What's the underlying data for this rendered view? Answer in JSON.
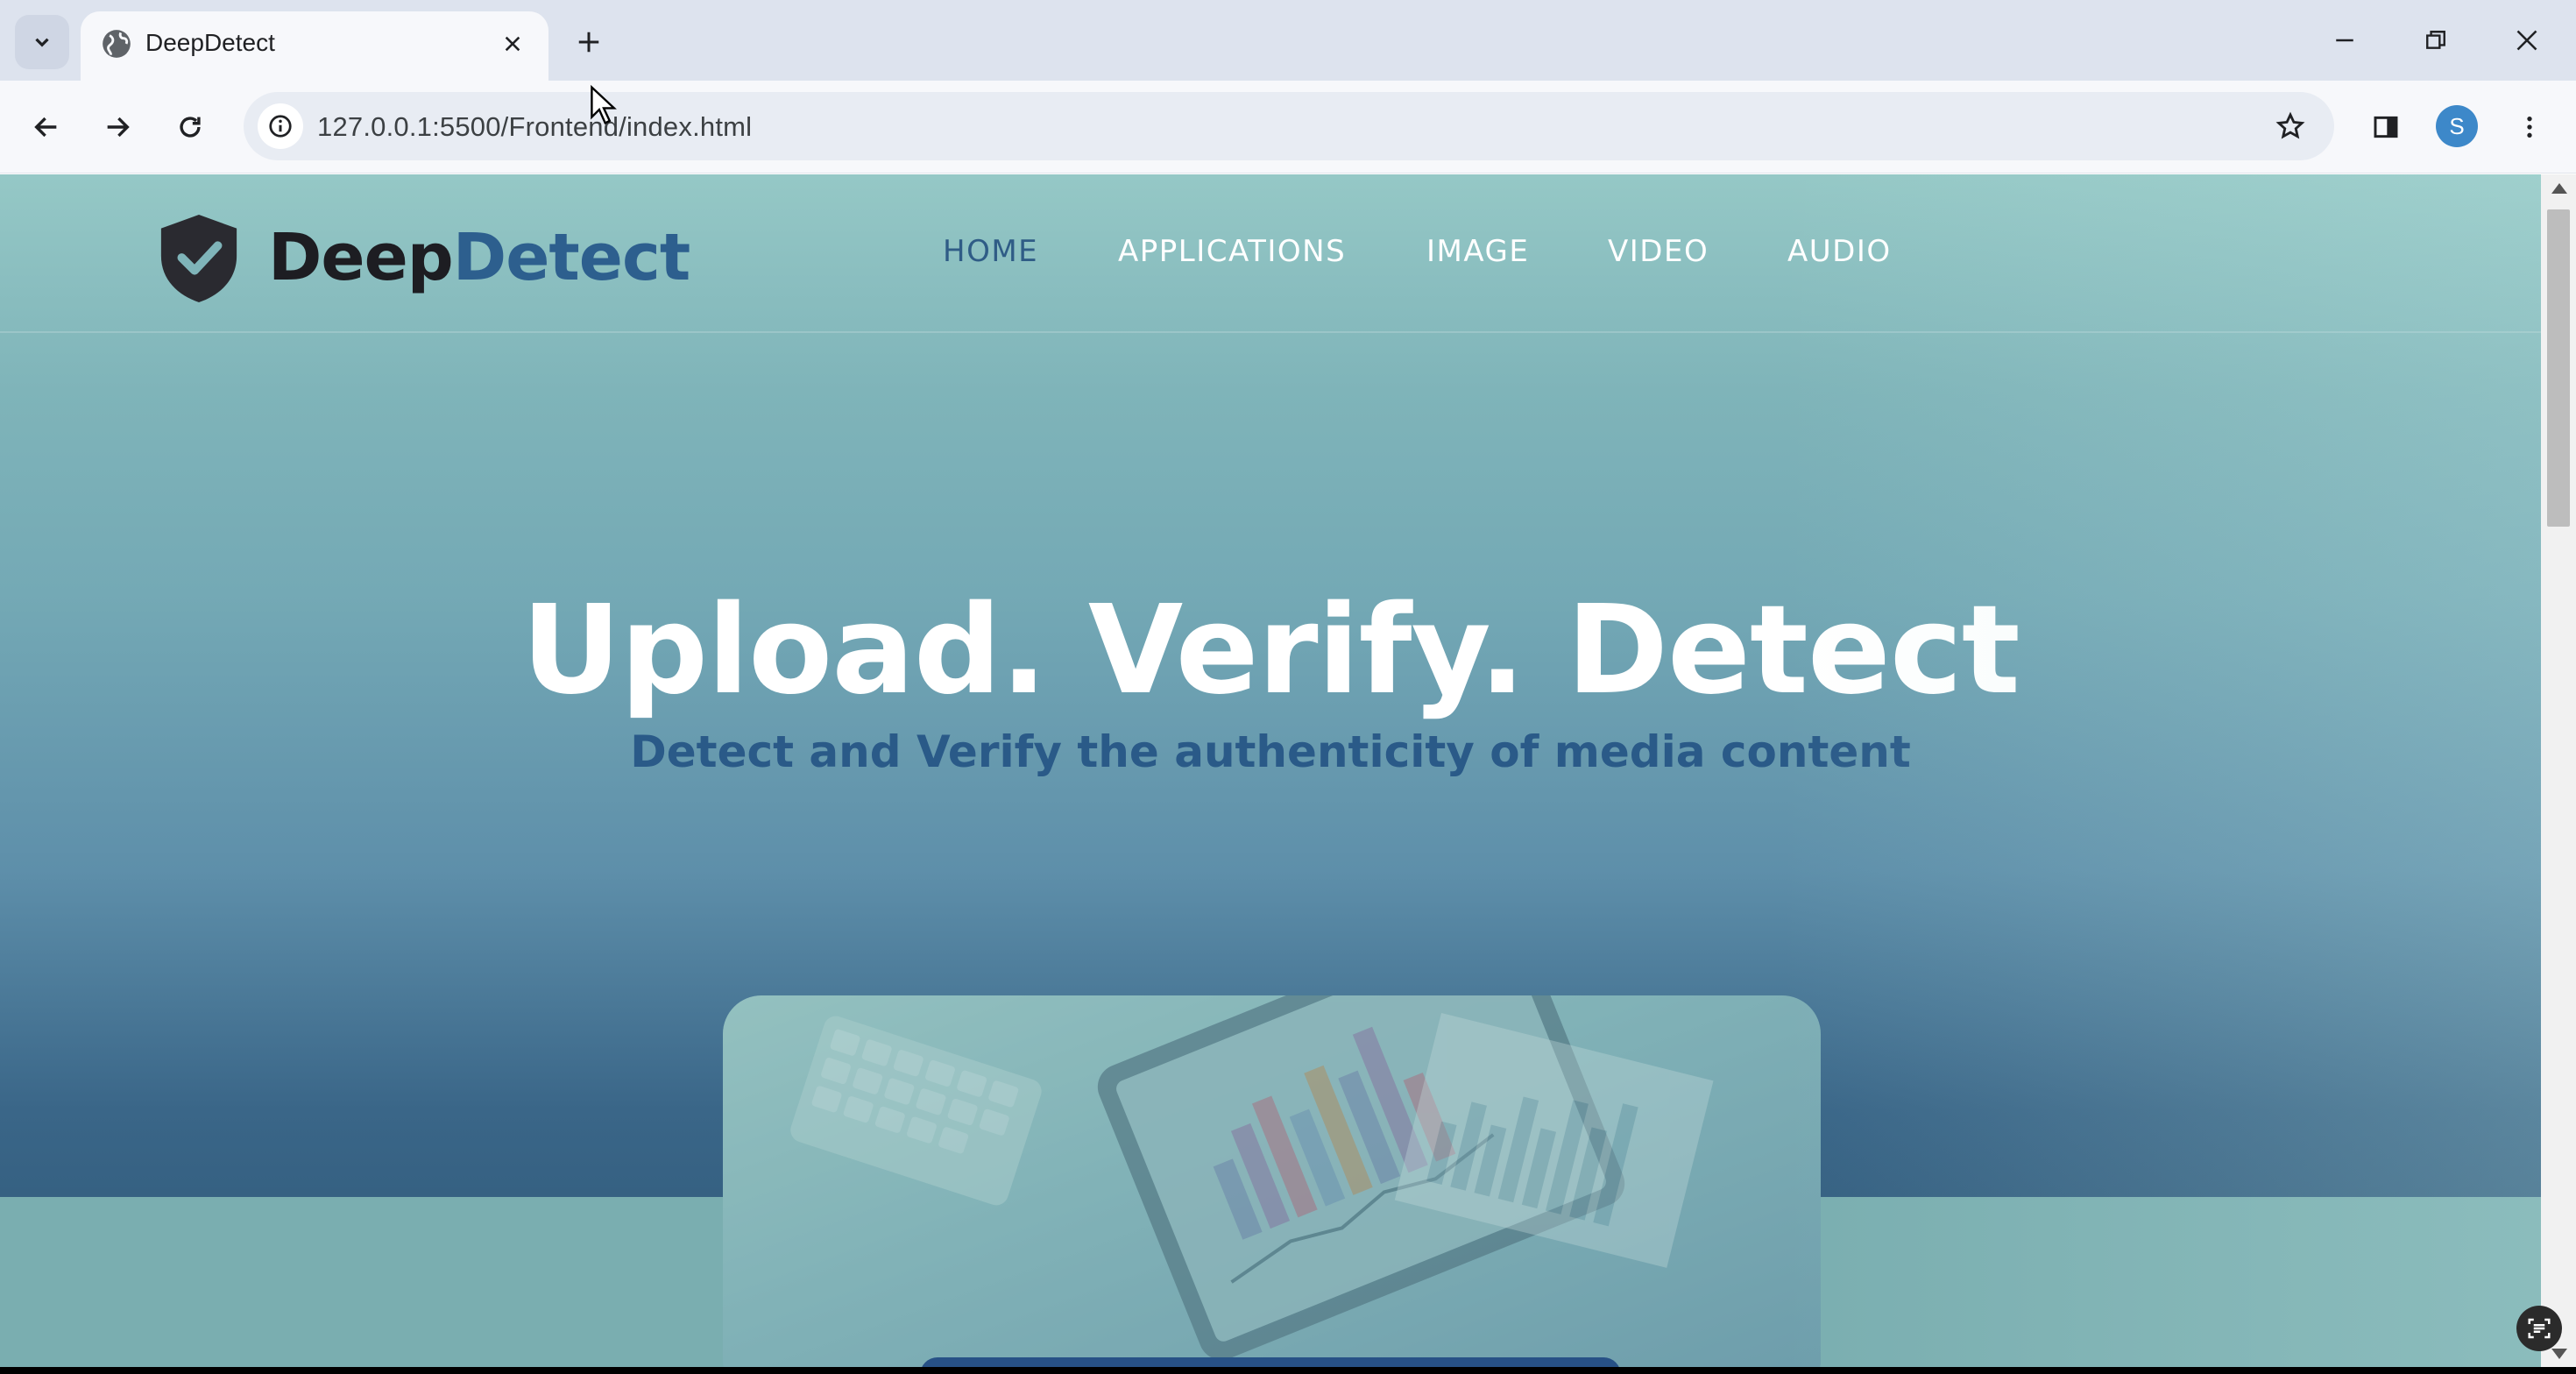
{
  "browser": {
    "tab": {
      "title": "DeepDetect"
    },
    "url": "127.0.0.1:5500/Frontend/index.html",
    "profile_initial": "S"
  },
  "site": {
    "logo": {
      "part1": "Deep",
      "part2": "Detect"
    },
    "nav": [
      {
        "label": "HOME",
        "active": true
      },
      {
        "label": "APPLICATIONS",
        "active": false
      },
      {
        "label": "IMAGE",
        "active": false
      },
      {
        "label": "VIDEO",
        "active": false
      },
      {
        "label": "AUDIO",
        "active": false
      }
    ],
    "hero": {
      "title": "Upload. Verify. Detect",
      "subtitle": "Detect and Verify the authenticity of media content"
    }
  },
  "colors": {
    "logo_dark": "#1d1d22",
    "logo_accent": "#2d5f8e",
    "nav_active": "#2f5c86",
    "subtitle": "#2a5a88"
  }
}
